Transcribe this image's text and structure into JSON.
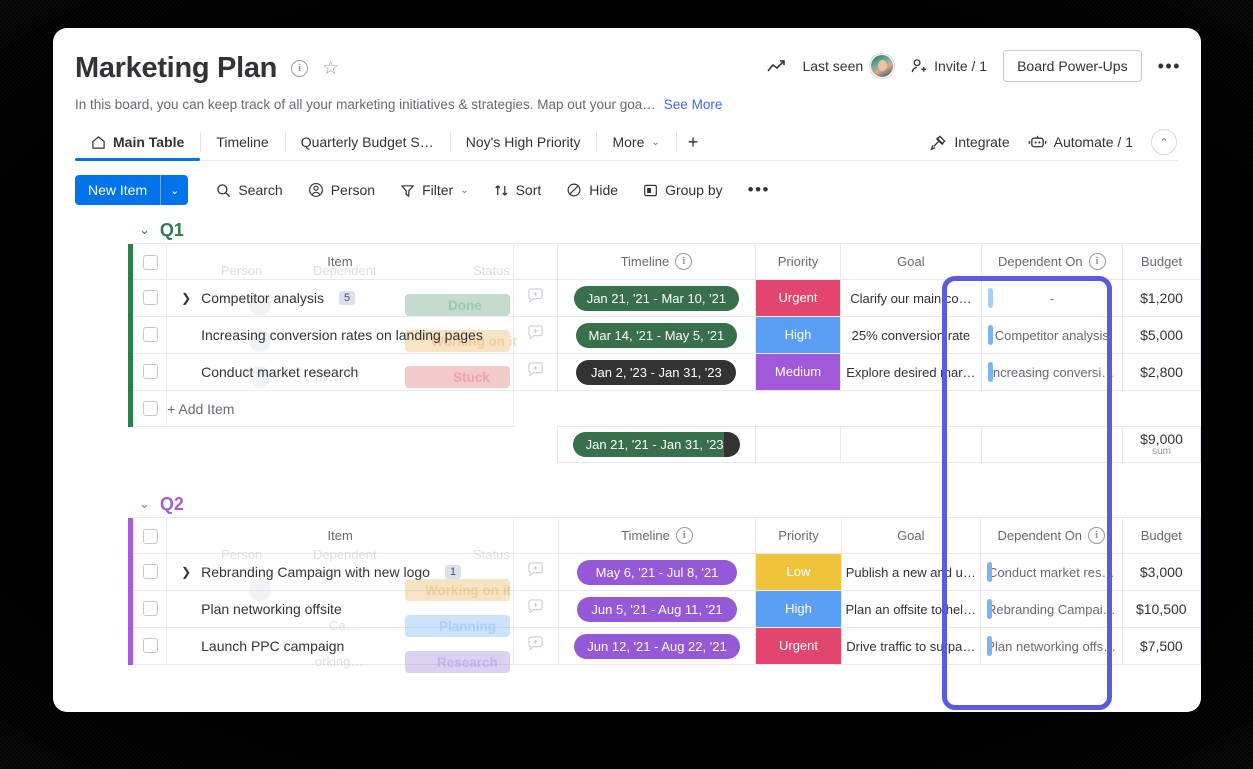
{
  "header": {
    "title": "Marketing Plan",
    "info_icon": "info-circle-icon",
    "star_icon": "star-icon",
    "description": "In this board, you can keep track of all your marketing initiatives & strategies. Map out your goa…",
    "see_more": "See More",
    "activity_icon": "activity-graph-icon",
    "last_seen": "Last seen",
    "invite": "Invite / 1",
    "power_ups": "Board Power-Ups",
    "more_menu": "•••"
  },
  "tabs": {
    "items": [
      {
        "label": "Main Table",
        "icon": "home-icon",
        "active": true
      },
      {
        "label": "Timeline",
        "active": false
      },
      {
        "label": "Quarterly Budget S…",
        "active": false
      },
      {
        "label": "Noy's High Priority",
        "active": false
      },
      {
        "label": "More",
        "active": false,
        "caret": "⌄"
      }
    ],
    "add_view": "+",
    "integrate": "Integrate",
    "automate": "Automate / 1",
    "collapse": "⌃"
  },
  "toolbar": {
    "new_item": "New Item",
    "new_item_caret": "⌄",
    "search": "Search",
    "person": "Person",
    "filter": "Filter",
    "filter_caret": "⌄",
    "sort": "Sort",
    "hide": "Hide",
    "group_by": "Group by",
    "overflow": "•••"
  },
  "columns": {
    "item": "Item",
    "timeline": "Timeline",
    "priority": "Priority",
    "goal": "Goal",
    "dependent_on": "Dependent On",
    "budget": "Budget",
    "ghost_person": "Person",
    "ghost_dependent": "Dependent",
    "ghost_status": "Status"
  },
  "colors": {
    "accent_blue": "#0073ea",
    "highlight_border": "#5a5ce0",
    "q1_green": "#2e7d4f",
    "q2_purple": "#a25ddc",
    "urgent": "#e2456d",
    "high": "#5a9ef5",
    "medium": "#a259d9",
    "low": "#efc33c",
    "timeline_green": "#37704a",
    "timeline_dark": "#333333",
    "timeline_purple": "#9558d6"
  },
  "groups": [
    {
      "name": "Q1",
      "color": "#2e7d4f",
      "caret": "⌄",
      "rows": [
        {
          "item": "Competitor analysis",
          "subitem_count": "5",
          "expandable": true,
          "timeline": "Jan 21, '21 - Mar 10, '21",
          "timeline_style": "green",
          "priority": "Urgent",
          "priority_color": "#e2456d",
          "goal": "Clarify our main co…",
          "dependent_on": "-",
          "budget": "$1,200",
          "ghost_status": "Done"
        },
        {
          "item": "Increasing conversion rates on landing pages",
          "subitem_count": "",
          "expandable": false,
          "timeline": "Mar 14, '21 - May 5, '21",
          "timeline_style": "green",
          "priority": "High",
          "priority_color": "#5a9ef5",
          "goal": "25% conversion rate",
          "dependent_on": "Competitor analysis",
          "budget": "$5,000",
          "ghost_status": "Working on it"
        },
        {
          "item": "Conduct market research",
          "subitem_count": "",
          "expandable": false,
          "timeline": "Jan 2, '23 - Jan 31, '23",
          "timeline_style": "dark",
          "priority": "Medium",
          "priority_color": "#a259d9",
          "goal": "Explore desired mar…",
          "dependent_on": "Increasing conversi…",
          "budget": "$2,800",
          "ghost_status": "Stuck"
        }
      ],
      "add_item": "+ Add Item",
      "summary": {
        "timeline": "Jan 21, '21 - Jan 31, '23",
        "budget_amount": "$9,000",
        "budget_label": "sum"
      }
    },
    {
      "name": "Q2",
      "color": "#a25ddc",
      "caret": "⌄",
      "rows": [
        {
          "item": "Rebranding Campaign with new logo",
          "subitem_count": "1",
          "expandable": true,
          "timeline": "May 6, '21 - Jul 8, '21",
          "timeline_style": "purple",
          "priority": "Low",
          "priority_color": "#efc33c",
          "goal": "Publish a new and u…",
          "dependent_on": "Conduct market res…",
          "budget": "$3,000",
          "ghost_status": "Working on it"
        },
        {
          "item": "Plan networking offsite",
          "subitem_count": "",
          "expandable": false,
          "timeline": "Jun 5, '21 - Aug 11, '21",
          "timeline_style": "purple",
          "priority": "High",
          "priority_color": "#5a9ef5",
          "goal": "Plan an offsite to hel…",
          "dependent_on": "Rebranding Campai…",
          "budget": "$10,500",
          "ghost_status": "Planning"
        },
        {
          "item": "Launch PPC campaign",
          "subitem_count": "",
          "expandable": false,
          "timeline": "Jun 12, '21 - Aug 22, '21",
          "timeline_style": "purple",
          "priority": "Urgent",
          "priority_color": "#e2456d",
          "goal": "Drive traffic to surpa…",
          "dependent_on": "Plan networking offs…",
          "budget": "$7,500",
          "ghost_status": "Research"
        }
      ]
    }
  ]
}
